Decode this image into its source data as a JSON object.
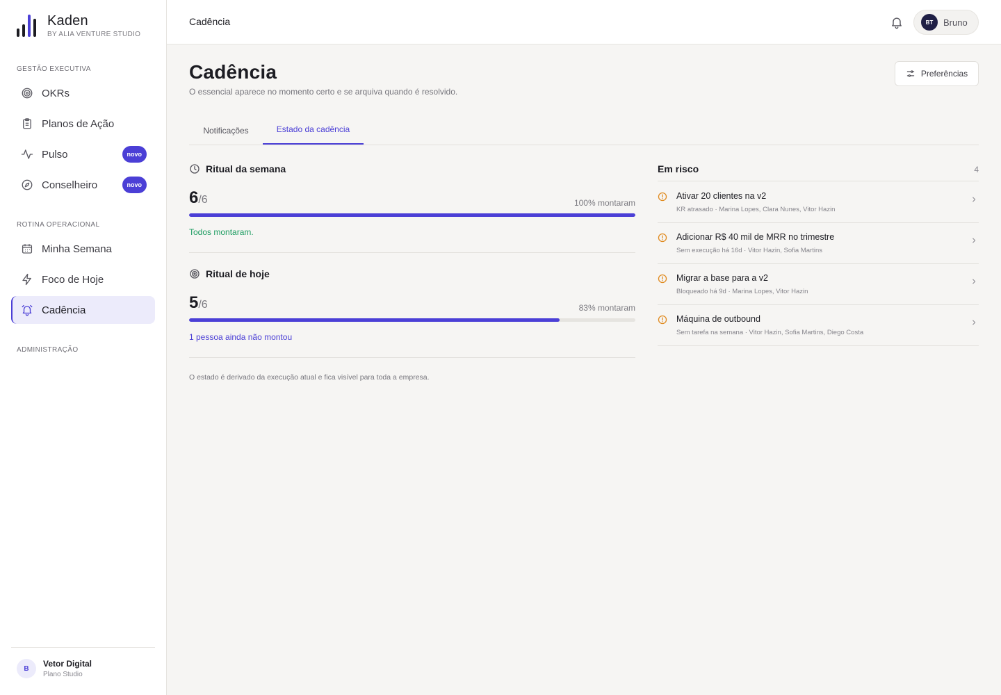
{
  "brand": {
    "name": "Kaden",
    "tagline": "BY ALIA VENTURE STUDIO"
  },
  "sidebar": {
    "sections": [
      {
        "label": "GESTÃO EXECUTIVA"
      },
      {
        "label": "ROTINA OPERACIONAL"
      },
      {
        "label": "ADMINISTRAÇÃO"
      }
    ],
    "items": [
      {
        "label": "OKRs",
        "icon": "target-icon"
      },
      {
        "label": "Planos de Ação",
        "icon": "clipboard-icon"
      },
      {
        "label": "Pulso",
        "icon": "activity-icon",
        "badge": "novo"
      },
      {
        "label": "Conselheiro",
        "icon": "compass-icon",
        "badge": "novo"
      },
      {
        "label": "Minha Semana",
        "icon": "calendar-icon"
      },
      {
        "label": "Foco de Hoje",
        "icon": "bolt-icon"
      },
      {
        "label": "Cadência",
        "icon": "alarm-bell-icon",
        "active": true
      }
    ],
    "org": {
      "initial": "B",
      "name": "Vetor Digital",
      "plan": "Plano Studio"
    }
  },
  "topbar": {
    "title": "Cadência",
    "user": {
      "initials": "BT",
      "name": "Bruno"
    }
  },
  "page": {
    "title": "Cadência",
    "subtitle": "O essencial aparece no momento certo e se arquiva quando é resolvido.",
    "preferences_label": "Preferências",
    "tabs": [
      {
        "label": "Notificações",
        "active": false
      },
      {
        "label": "Estado da cadência",
        "active": true
      }
    ]
  },
  "rituals": [
    {
      "title": "Ritual da semana",
      "count": "6",
      "total": "/6",
      "percent_label": "100% montaram",
      "progress": 1.0,
      "note": "Todos montaram.",
      "note_status": "ok"
    },
    {
      "title": "Ritual de hoje",
      "count": "5",
      "total": "/6",
      "percent_label": "83% montaram",
      "progress": 0.83,
      "note": "1 pessoa ainda não montou",
      "note_status": "pending"
    }
  ],
  "footnote": "O estado é derivado da execução atual e fica visível para toda a empresa.",
  "risk": {
    "title": "Em risco",
    "count": "4",
    "items": [
      {
        "title": "Ativar 20 clientes na v2",
        "meta": "KR atrasado · Marina Lopes, Clara Nunes, Vitor Hazin"
      },
      {
        "title": "Adicionar R$ 40 mil de MRR no trimestre",
        "meta": "Sem execução há 16d · Vitor Hazin, Sofia Martins"
      },
      {
        "title": "Migrar a base para a v2",
        "meta": "Bloqueado há 9d · Marina Lopes, Vitor Hazin"
      },
      {
        "title": "Máquina de outbound",
        "meta": "Sem tarefa na semana · Vitor Hazin, Sofia Martins, Diego Costa"
      }
    ]
  },
  "colors": {
    "accent": "#4b3fd6",
    "ok": "#1e9d62",
    "warning": "#e08a1e"
  }
}
